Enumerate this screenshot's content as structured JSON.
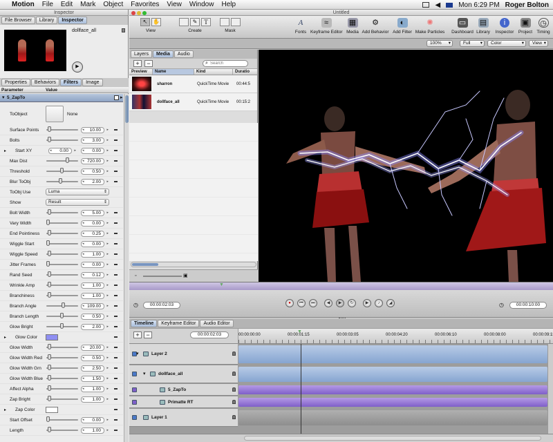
{
  "menubar": {
    "apple": "",
    "app_name": "Motion",
    "items": [
      "File",
      "Edit",
      "Mark",
      "Object",
      "Favorites",
      "View",
      "Window",
      "Help"
    ],
    "clock": "Mon 6:29 PM",
    "user": "Roger Bolton"
  },
  "inspector": {
    "window_title": "Inspector",
    "top_tabs": [
      "File Browser",
      "Library",
      "Inspector"
    ],
    "clip_name": "dollface_all",
    "tabs": [
      "Properties",
      "Behaviors",
      "Filters",
      "Image"
    ],
    "col_param": "Parameter",
    "col_value": "Value",
    "filter_name": "5_ZapTo",
    "toobject_label": "ToObject",
    "toobject_value": "None",
    "params": [
      {
        "label": "Surface Points",
        "value": "10.00",
        "pos": 0.04
      },
      {
        "label": "Bolts",
        "value": "3.00",
        "pos": 0.05
      },
      {
        "label": "Start XY",
        "value": "0.00",
        "value2": "0.00"
      },
      {
        "label": "Max Dist",
        "value": "720.00",
        "pos": 0.7
      },
      {
        "label": "Threshold",
        "value": "0.50",
        "pos": 0.5
      },
      {
        "label": "Blur ToObj",
        "value": "2.00",
        "pos": 0.45
      },
      {
        "label": "ToObj Use",
        "popup": "Luma"
      },
      {
        "label": "Show",
        "popup": "Result"
      },
      {
        "label": "Bolt Width",
        "value": "5.00",
        "pos": 0.05
      },
      {
        "label": "Vary Width",
        "value": "0.00",
        "pos": 0.0
      },
      {
        "label": "End Pointiness",
        "value": "0.25",
        "pos": 0.05
      },
      {
        "label": "Wiggle Start",
        "value": "0.00",
        "pos": 0.0
      },
      {
        "label": "Wiggle Speed",
        "value": "1.00",
        "pos": 0.05
      },
      {
        "label": "Jitter Frames",
        "value": "0.00",
        "pos": 0.0
      },
      {
        "label": "Rand Seed",
        "value": "0.12",
        "pos": 0.05
      },
      {
        "label": "Wrinkle Amp",
        "value": "1.00",
        "pos": 0.05
      },
      {
        "label": "Branchiness",
        "value": "1.00",
        "pos": 0.05
      },
      {
        "label": "Branch Angle",
        "value": "109.00",
        "pos": 0.55
      },
      {
        "label": "Branch Length",
        "value": "0.50",
        "pos": 0.5
      },
      {
        "label": "Glow Bright",
        "value": "2.00",
        "pos": 0.5
      },
      {
        "label": "Glow Color",
        "swatch": "#8f8ff2"
      },
      {
        "label": "Glow Width",
        "value": "20.00",
        "pos": 0.05
      },
      {
        "label": "Glow Width Red",
        "value": "0.50",
        "pos": 0.05
      },
      {
        "label": "Glow Width Grn",
        "value": "2.50",
        "pos": 0.05
      },
      {
        "label": "Glow Width Blue",
        "value": "1.50",
        "pos": 0.05
      },
      {
        "label": "Affect Alpha",
        "value": "1.00",
        "pos": 0.05
      },
      {
        "label": "Zap Bright",
        "value": "1.00",
        "pos": 0.05
      },
      {
        "label": "Zap Color",
        "swatch": "#ffffff"
      },
      {
        "label": "Start Offset",
        "value": "0.00",
        "pos": 0.0
      },
      {
        "label": "Length",
        "value": "1.00",
        "pos": 0.05
      }
    ]
  },
  "main": {
    "window_title": "Untitled",
    "tools": {
      "view": "View",
      "create": "Create",
      "mask": "Mask"
    },
    "toolbar_items": [
      "Fonts",
      "Keyframe Editor",
      "Media",
      "Add Behavior",
      "Add Filter",
      "Make Particles",
      "Dashboard",
      "Library",
      "Inspector",
      "Project",
      "Timing"
    ],
    "zoom": "100%",
    "res": "Full",
    "channel": "Color",
    "view_menu": "View",
    "panel_tabs": [
      "Layers",
      "Media",
      "Audio"
    ],
    "search_placeholder": "Search",
    "media_cols": [
      "Preview",
      "Name",
      "Kind",
      "Duratio"
    ],
    "media_rows": [
      {
        "name": "sharron",
        "kind": "QuickTime Movie",
        "duration": "00:44:5"
      },
      {
        "name": "dollface_all",
        "kind": "QuickTime Movie",
        "duration": "00:15:2"
      }
    ]
  },
  "transport": {
    "current_time": "00:00:02:03",
    "end_time": "00:00:10:00"
  },
  "timeline": {
    "tabs": [
      "Timeline",
      "Keyframe Editor",
      "Audio Editor"
    ],
    "timecode": "00:00:02:03",
    "ruler": [
      "00:00:00:00",
      "00:00:01:15",
      "00:00:03:05",
      "00:00:04:20",
      "00:00:06:10",
      "00:00:08:00",
      "00:00:09:15"
    ],
    "layers": [
      {
        "name": "Layer 2"
      },
      {
        "name": "dollface_all"
      },
      {
        "name": "5_ZapTo"
      },
      {
        "name": "Primatte RT"
      },
      {
        "name": "Layer 1"
      }
    ]
  },
  "colors": {
    "accent": "#4a78c8",
    "filter_bar": "#8f6fd0",
    "layer_bar": "#7ea6d8"
  }
}
